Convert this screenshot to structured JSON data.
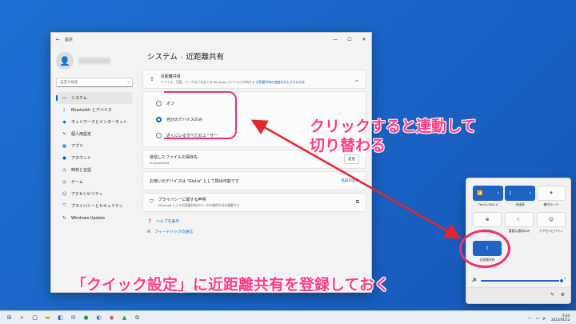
{
  "window": {
    "title": "設定",
    "back_glyph": "←",
    "controls": [
      "—",
      "☐",
      "✕"
    ]
  },
  "sidebar": {
    "search_placeholder": "設定の検索",
    "items": [
      {
        "label": "システム",
        "icon": "monitor-icon",
        "glyph": "▭"
      },
      {
        "label": "Bluetooth とデバイス",
        "icon": "bluetooth-icon",
        "glyph": "ᛒ"
      },
      {
        "label": "ネットワークとインターネット",
        "icon": "network-icon",
        "glyph": "◆"
      },
      {
        "label": "個人用設定",
        "icon": "brush-icon",
        "glyph": "✎"
      },
      {
        "label": "アプリ",
        "icon": "apps-icon",
        "glyph": "▦"
      },
      {
        "label": "アカウント",
        "icon": "account-icon",
        "glyph": "●"
      },
      {
        "label": "時刻と言語",
        "icon": "clock-icon",
        "glyph": "◷"
      },
      {
        "label": "ゲーム",
        "icon": "game-icon",
        "glyph": "◎"
      },
      {
        "label": "アクセシビリティ",
        "icon": "accessibility-icon",
        "glyph": "☺"
      },
      {
        "label": "プライバシーとセキュリティ",
        "icon": "shield-icon",
        "glyph": "⛉"
      },
      {
        "label": "Windows Update",
        "icon": "update-icon",
        "glyph": "↻"
      }
    ]
  },
  "main": {
    "breadcrumb_parent": "システム",
    "breadcrumb_sep": "›",
    "breadcrumb_current": "近距離共有",
    "nearby": {
      "title": "近距離共有",
      "desc": "ファイル、写真、リンクなどを近くの Windows デバイスと共有する",
      "desc_link": "近距離共有の速度を向上させる方法"
    },
    "radios": [
      {
        "label": "オフ",
        "selected": false
      },
      {
        "label": "自分のデバイスのみ",
        "selected": true
      },
      {
        "label": "近くにいるすべてのユーザー",
        "selected": false
      }
    ],
    "save_folder": {
      "title": "受信したファイルの保存先",
      "value": "D:\\Download",
      "button": "変更"
    },
    "device_name": {
      "title": "お使いのデバイスは \"Giulia\" として検出可能です",
      "link": "名前の変更"
    },
    "privacy": {
      "title": "プライバシーに関する声明",
      "desc": "Microsoft による近距離共有のデータの使用方法を理解する"
    },
    "help_link": "ヘルプを表示",
    "feedback_link": "フィードバックの送信"
  },
  "quick_settings": {
    "tiles": [
      {
        "label": "Fbk04-Ts5E-A",
        "glyph": "📶"
      },
      {
        "label": "未接続",
        "glyph": "ᛒ"
      },
      {
        "label": "機内モード",
        "glyph": "✈"
      },
      {
        "label": "省エネ",
        "glyph": "⊕"
      },
      {
        "label": "重要な通知のみ",
        "glyph": "☾"
      },
      {
        "label": "アクセシビリティ",
        "glyph": "☺"
      },
      {
        "label": "近距離共有",
        "glyph": "⇪"
      }
    ]
  },
  "annotations": {
    "top": "クリックすると連動して\n切り替わる",
    "bottom": "「クイック設定」に近距離共有を登録しておく"
  },
  "taskbar": {
    "time": "9:04",
    "date": "2022/04/22"
  },
  "colors": {
    "accent": "#0067c0",
    "annotation": "#ff3b86"
  }
}
